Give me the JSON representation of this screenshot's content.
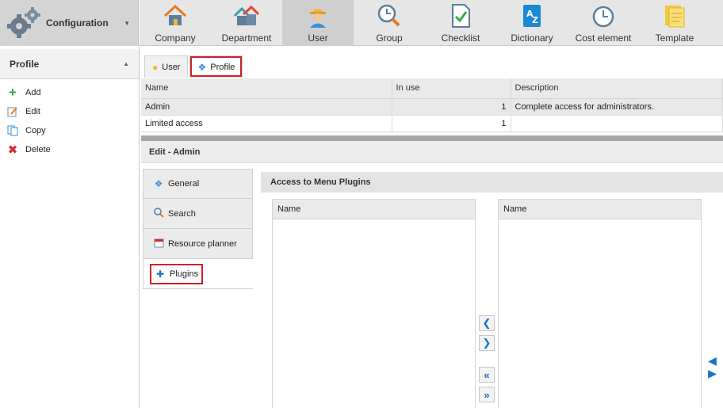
{
  "config": {
    "title": "Configuration"
  },
  "ribbon": [
    {
      "label": "Company",
      "icon": "house-icon"
    },
    {
      "label": "Department",
      "icon": "houses-icon"
    },
    {
      "label": "User",
      "icon": "worker-icon"
    },
    {
      "label": "Group",
      "icon": "group-clock-icon"
    },
    {
      "label": "Checklist",
      "icon": "checklist-icon"
    },
    {
      "label": "Dictionary",
      "icon": "dictionary-icon"
    },
    {
      "label": "Cost element",
      "icon": "clock-icon"
    },
    {
      "label": "Template",
      "icon": "template-icon"
    }
  ],
  "sidebar": {
    "title": "Profile",
    "items": [
      {
        "label": "Add",
        "icon": "plus-icon"
      },
      {
        "label": "Edit",
        "icon": "edit-icon"
      },
      {
        "label": "Copy",
        "icon": "copy-icon"
      },
      {
        "label": "Delete",
        "icon": "delete-icon"
      }
    ]
  },
  "tabs": {
    "user": "User",
    "profile": "Profile"
  },
  "grid": {
    "columns": [
      "Name",
      "In use",
      "Description"
    ],
    "rows": [
      {
        "name": "Admin",
        "in_use": "1",
        "description": "Complete access for administrators."
      },
      {
        "name": "Limited access",
        "in_use": "1",
        "description": ""
      }
    ]
  },
  "edit": {
    "title": "Edit - Admin",
    "vtabs": [
      "General",
      "Search",
      "Resource planner",
      "Plugins"
    ]
  },
  "plugins": {
    "title": "Access to Menu Plugins",
    "left_header": "Name",
    "right_header": "Name"
  },
  "colors": {
    "accent": "#1a73c8",
    "highlight": "#d0202a"
  }
}
